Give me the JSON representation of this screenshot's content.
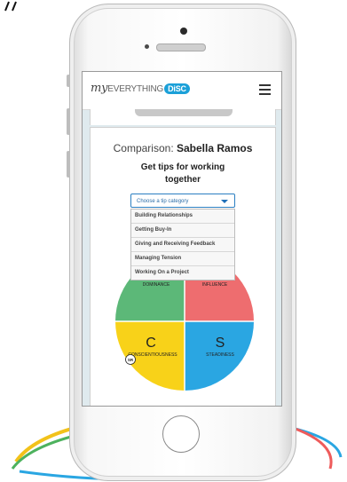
{
  "brand": {
    "prefix": "my",
    "word": "EVERYTHING",
    "disc": "DiSC"
  },
  "comparison": {
    "label": "Comparison:",
    "name": "Sabella Ramos"
  },
  "tips_heading": "Get tips for working together",
  "select": {
    "placeholder": "Choose a tip category"
  },
  "menu_items": [
    "Building Relationships",
    "Getting Buy-In",
    "Giving and Receiving Feedback",
    "Managing Tension",
    "Working On a Project"
  ],
  "wheel": {
    "d_label": "DOMINANCE",
    "i_label": "INFLUENCE",
    "c_letter": "C",
    "c_label": "CONSCIENTIOUSNESS",
    "s_letter": "S",
    "s_label": "STEADINESS",
    "marker": "SR"
  },
  "colors": {
    "d": "#5cb878",
    "i": "#ee6d6f",
    "c": "#f8d219",
    "s": "#2aa6e2",
    "accent": "#1ba0d8"
  }
}
